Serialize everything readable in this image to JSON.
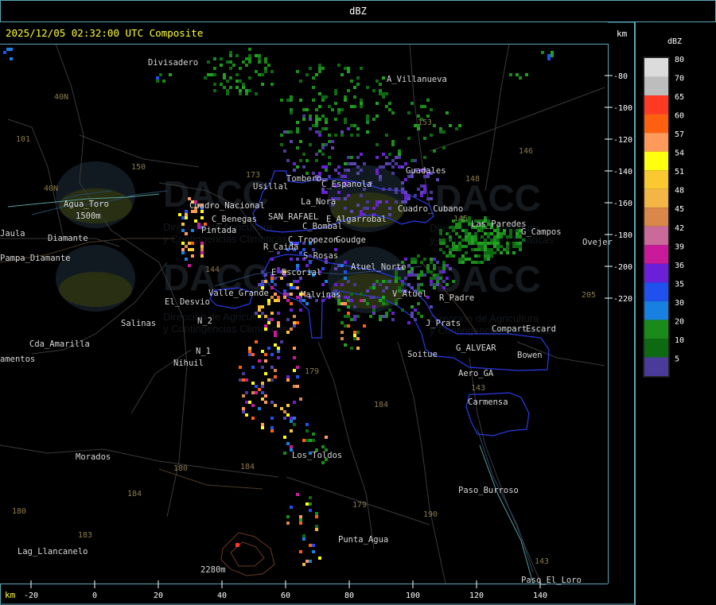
{
  "header": {
    "unit_title": "dBZ"
  },
  "map": {
    "timestamp": "2025/12/05 02:32:00 UTC Composite",
    "unit_top_right": "km",
    "unit_bottom_left": "km"
  },
  "axes": {
    "x_ticks": [
      "-20",
      "0",
      "20",
      "40",
      "60",
      "80",
      "100",
      "120",
      "140"
    ],
    "y_ticks": [
      "-80",
      "-100",
      "-120",
      "-140",
      "-160",
      "-180",
      "-200",
      "-220"
    ]
  },
  "legend": {
    "title": "dBZ",
    "levels": [
      {
        "label": "80",
        "color": "#dcdcdc"
      },
      {
        "label": "70",
        "color": "#bdbdbd"
      },
      {
        "label": "65",
        "color": "#ff3a24"
      },
      {
        "label": "60",
        "color": "#ff6010"
      },
      {
        "label": "57",
        "color": "#ff9a5a"
      },
      {
        "label": "54",
        "color": "#ffff10"
      },
      {
        "label": "51",
        "color": "#fac830"
      },
      {
        "label": "48",
        "color": "#f3b545"
      },
      {
        "label": "45",
        "color": "#d9874a"
      },
      {
        "label": "42",
        "color": "#c96a9a"
      },
      {
        "label": "39",
        "color": "#c81a9a"
      },
      {
        "label": "36",
        "color": "#6a20d8"
      },
      {
        "label": "35",
        "color": "#2050ee"
      },
      {
        "label": "30",
        "color": "#1880e0"
      },
      {
        "label": "20",
        "color": "#1a8a1a"
      },
      {
        "label": "10",
        "color": "#0e6a12"
      },
      {
        "label": "5",
        "color": "#4a3a9a"
      }
    ]
  },
  "places": [
    {
      "name": "Divisadero"
    },
    {
      "name": "A_Villanueva"
    },
    {
      "name": "Guadales"
    },
    {
      "name": "Usillal"
    },
    {
      "name": "Tombero"
    },
    {
      "name": "C_Espanola"
    },
    {
      "name": "La_Nora"
    },
    {
      "name": "Agua_Toro"
    },
    {
      "name": "1500m"
    },
    {
      "name": "Pampa_Diamante"
    },
    {
      "name": "Cuadro_Nacional"
    },
    {
      "name": "Pintada"
    },
    {
      "name": "C_Benegas"
    },
    {
      "name": "SAN_RAFAEL"
    },
    {
      "name": "E_Algarrobal"
    },
    {
      "name": "C_Bombal"
    },
    {
      "name": "C_Tropezon"
    },
    {
      "name": "Goudge"
    },
    {
      "name": "R_Caida"
    },
    {
      "name": "S_Rosas"
    },
    {
      "name": "Atuel_Norte"
    },
    {
      "name": "E_Escorial"
    },
    {
      "name": "Valle_Grande"
    },
    {
      "name": "Malvinas"
    },
    {
      "name": "V_Atuel"
    },
    {
      "name": "R_Padre"
    },
    {
      "name": "El_Desvio"
    },
    {
      "name": "Salinas"
    },
    {
      "name": "N_2"
    },
    {
      "name": "N_1"
    },
    {
      "name": "Nihuil"
    },
    {
      "name": "Cda_Amarilla"
    },
    {
      "name": "J_Prats"
    },
    {
      "name": "Compart"
    },
    {
      "name": "Escard"
    },
    {
      "name": "G_ALVEAR"
    },
    {
      "name": "Soitue"
    },
    {
      "name": "Bowen"
    },
    {
      "name": "Aero_GA"
    },
    {
      "name": "Carmensa"
    },
    {
      "name": "G_Campos"
    },
    {
      "name": "Morados"
    },
    {
      "name": "Los_Toldos"
    },
    {
      "name": "Paso_Burroso"
    },
    {
      "name": "Punta_Agua"
    },
    {
      "name": "Lag_Llancanelo"
    },
    {
      "name": "Paso_El_Loro"
    },
    {
      "name": "2280m"
    },
    {
      "name": "Jaula"
    },
    {
      "name": "Diamante"
    },
    {
      "name": "amentos"
    },
    {
      "name": "Ovejer"
    },
    {
      "name": "Cuadro_Cubano"
    },
    {
      "name": "Las_Paredes"
    }
  ],
  "routes": [
    "40N",
    "40N",
    "101",
    "150",
    "153",
    "146",
    "148",
    "145",
    "143",
    "184",
    "180",
    "184",
    "183",
    "184",
    "179",
    "180",
    "179",
    "190",
    "143",
    "205",
    "144",
    "173"
  ],
  "watermark": {
    "brand": "DACC",
    "line1": "Direccion de Agricultura",
    "line2": "y Contingencias Climaticas"
  }
}
